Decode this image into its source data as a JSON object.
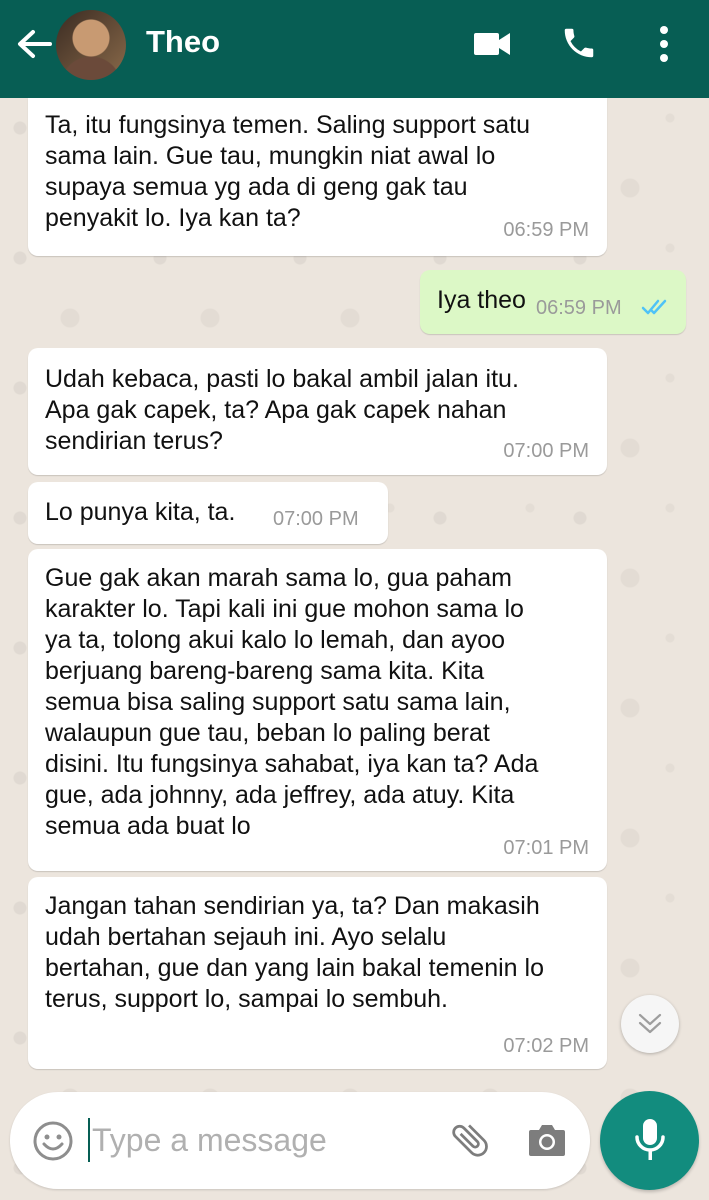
{
  "header": {
    "contact_name": "Theo",
    "icons": [
      "back-arrow-icon",
      "video-call-icon",
      "phone-icon",
      "more-vert-icon"
    ],
    "bg_color": "#075e54"
  },
  "messages": [
    {
      "direction": "incoming",
      "text": "Ta, itu fungsinya temen. Saling support satu\nsama lain. Gue tau, mungkin niat awal lo\nsupaya semua yg ada di geng gak tau\npenyakit lo. Iya kan ta?",
      "time": "06:59 PM"
    },
    {
      "direction": "outgoing",
      "text": "Iya theo",
      "time": "06:59 PM",
      "status": "read-double-tick-icon"
    },
    {
      "direction": "incoming",
      "text": "Udah kebaca, pasti lo bakal ambil jalan itu.\nApa gak capek, ta? Apa gak capek nahan\nsendirian terus?",
      "time": "07:00 PM"
    },
    {
      "direction": "incoming",
      "text": "Lo punya kita, ta.",
      "time": "07:00 PM"
    },
    {
      "direction": "incoming",
      "text": "Gue gak akan marah sama lo, gua paham\nkarakter lo. Tapi kali ini gue mohon sama lo\nya ta, tolong akui kalo lo lemah, dan ayoo\nberjuang bareng-bareng sama kita. Kita\nsemua bisa saling support satu sama lain,\nwalaupun gue tau, beban lo paling berat\ndisini. Itu fungsinya sahabat, iya kan ta? Ada\ngue, ada johnny, ada jeffrey, ada atuy. Kita\nsemua ada buat lo",
      "time": "07:01 PM"
    },
    {
      "direction": "incoming",
      "text": "Jangan tahan sendirian ya, ta? Dan makasih\nudah bertahan sejauh ini. Ayo selalu\nbertahan, gue dan yang lain bakal temenin lo\nterus, support lo, sampai lo sembuh.",
      "time": "07:02 PM"
    }
  ],
  "composer": {
    "placeholder": "Type a message",
    "value": "",
    "icons": [
      "emoji-icon",
      "attach-icon",
      "camera-icon",
      "mic-icon"
    ],
    "accent_color": "#128c7e"
  },
  "colors": {
    "incoming_bubble": "#ffffff",
    "outgoing_bubble": "#dcf8c6",
    "chat_background": "#ece5dd",
    "read_ticks": "#4fc3f7"
  }
}
